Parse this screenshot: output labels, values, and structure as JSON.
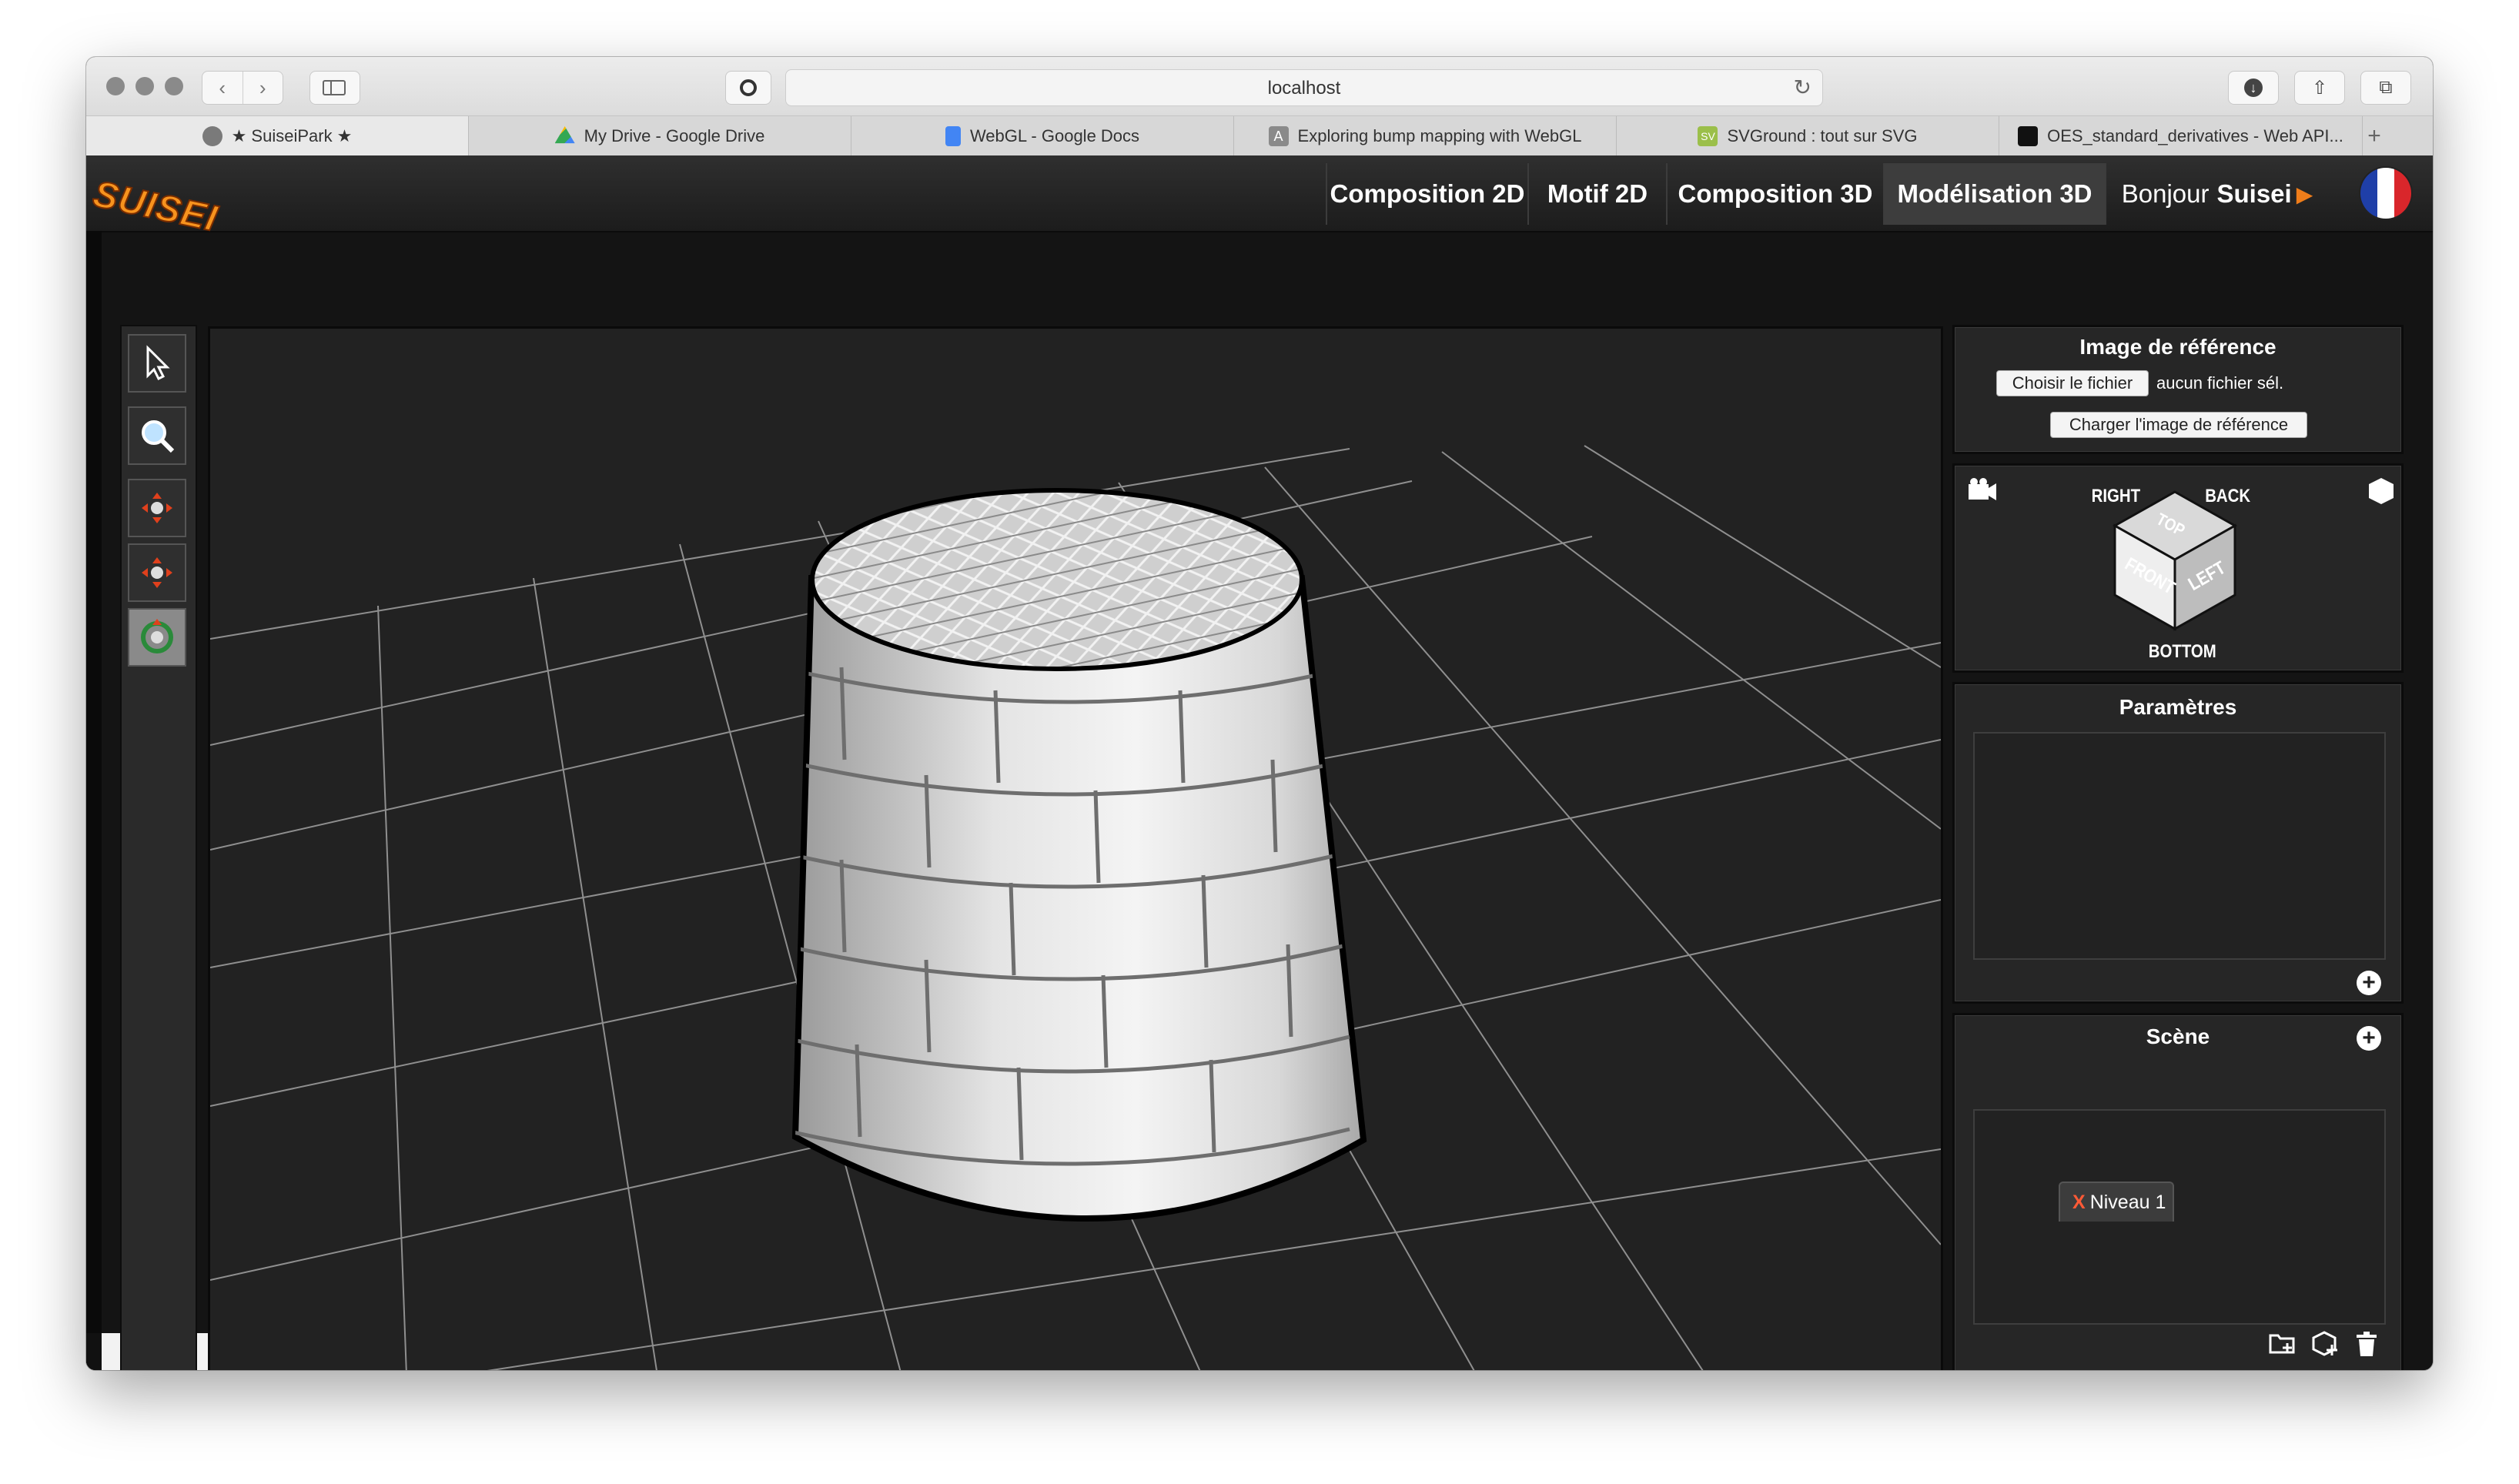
{
  "browser": {
    "url": "localhost",
    "tabs": [
      {
        "title": "★ SuiseiPark ★",
        "active": true,
        "favicon": "#7a7a7a"
      },
      {
        "title": "My Drive - Google Drive",
        "active": false,
        "favicon": "#34a853"
      },
      {
        "title": "WebGL - Google Docs",
        "active": false,
        "favicon": "#4285f4"
      },
      {
        "title": "Exploring bump mapping with WebGL",
        "active": false,
        "favicon": "#8a8a8a"
      },
      {
        "title": "SVGround : tout sur SVG",
        "active": false,
        "favicon": "#9bbf4a"
      },
      {
        "title": "OES_standard_derivatives - Web API...",
        "active": false,
        "favicon": "#111111"
      }
    ]
  },
  "app": {
    "logo": "SUISEI",
    "nav": {
      "composition2d": "Composition 2D",
      "motif2d": "Motif 2D",
      "composition3d": "Composition 3D",
      "modelisation3d": "Modélisation 3D",
      "greeting": "Bonjour",
      "user": "Suisei"
    },
    "reference_panel": {
      "title": "Image de référence",
      "choose_file": "Choisir le fichier",
      "no_file": "aucun fichier sél.",
      "load_button": "Charger l'image de référence"
    },
    "view_cube": {
      "right": "RIGHT",
      "back": "BACK",
      "top": "TOP",
      "front": "FRONT",
      "left": "LEFT",
      "bottom": "BOTTOM"
    },
    "parameters_panel": {
      "title": "Paramètres"
    },
    "scene_panel": {
      "title": "Scène",
      "layer_close": "X",
      "layer_name": "Niveau 1"
    },
    "colors": {
      "accent_orange": "#ef7d1a",
      "background": "#141414",
      "panel": "#262626",
      "viewport": "#222222"
    },
    "icons": [
      "pointer-icon",
      "magnifier-icon",
      "move-icon",
      "move-vertical-icon",
      "rotate-icon",
      "camera-icon",
      "cube-icon",
      "add-folder-icon",
      "add-object-icon",
      "trash-icon"
    ]
  }
}
